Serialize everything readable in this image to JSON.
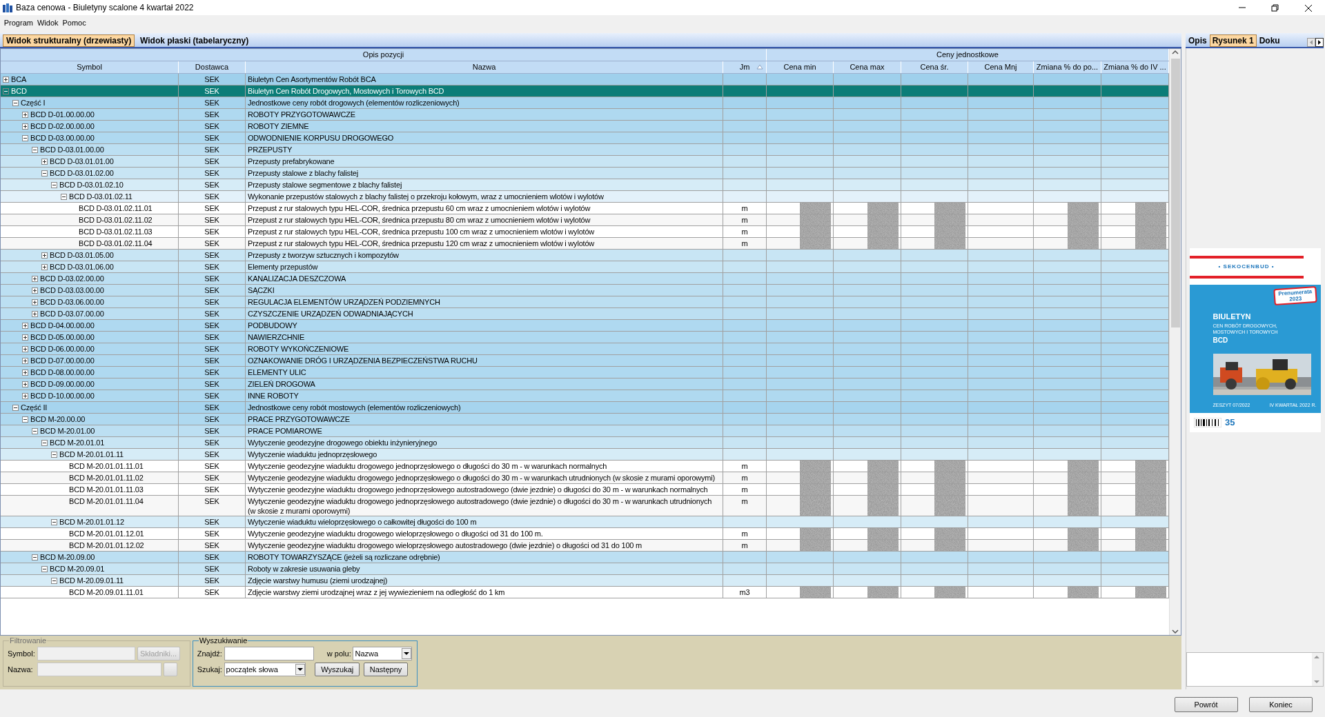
{
  "window": {
    "title": "Baza cenowa - Biuletyny scalone 4 kwartał 2022"
  },
  "menu": [
    "Program",
    "Widok",
    "Pomoc"
  ],
  "view_tabs": [
    {
      "label": "Widok strukturalny (drzewiasty)",
      "selected": true
    },
    {
      "label": "Widok płaski (tabelaryczny)",
      "selected": false
    }
  ],
  "table": {
    "groups": [
      "Opis pozycji",
      "Ceny jednostkowe"
    ],
    "columns": [
      {
        "label": "Symbol",
        "sorted": false
      },
      {
        "label": "Dostawca",
        "sorted": false
      },
      {
        "label": "Nazwa",
        "sorted": false
      },
      {
        "label": "Jm",
        "sorted": true
      },
      {
        "label": "Cena min",
        "sorted": false
      },
      {
        "label": "Cena max",
        "sorted": false
      },
      {
        "label": "Cena śr.",
        "sorted": false
      },
      {
        "label": "Cena Mnj",
        "sorted": false
      },
      {
        "label": "Zmiana % do po...",
        "sorted": false
      },
      {
        "label": "Zmiana % do IV ...",
        "sorted": false
      }
    ],
    "rows": [
      {
        "symbol": "BCA",
        "supplier": "SEK",
        "name": "Biuletyn Cen Asortymentów Robót BCA",
        "expanded": false,
        "selected": false
      },
      {
        "symbol": "BCD",
        "supplier": "SEK",
        "name": "Biuletyn Cen Robót Drogowych, Mostowych i Torowych BCD",
        "expanded": true,
        "selected": true,
        "children": [
          {
            "symbol": "Część I",
            "supplier": "SEK",
            "name": "Jednostkowe ceny robót drogowych (elementów rozliczeniowych)",
            "expanded": true,
            "selected": false,
            "children": [
              {
                "symbol": "BCD D-01.00.00.00",
                "supplier": "SEK",
                "name": "ROBOTY PRZYGOTOWAWCZE",
                "expanded": false,
                "selected": false
              },
              {
                "symbol": "BCD D-02.00.00.00",
                "supplier": "SEK",
                "name": "ROBOTY ZIEMNE",
                "expanded": false,
                "selected": false
              },
              {
                "symbol": "BCD D-03.00.00.00",
                "supplier": "SEK",
                "name": "ODWODNIENIE KORPUSU DROGOWEGO",
                "expanded": true,
                "selected": false,
                "children": [
                  {
                    "symbol": "BCD D-03.01.00.00",
                    "supplier": "SEK",
                    "name": "PRZEPUSTY",
                    "expanded": true,
                    "selected": false,
                    "children": [
                      {
                        "symbol": "BCD D-03.01.01.00",
                        "supplier": "SEK",
                        "name": "Przepusty prefabrykowane",
                        "expanded": false,
                        "selected": false
                      },
                      {
                        "symbol": "BCD D-03.01.02.00",
                        "supplier": "SEK",
                        "name": "Przepusty stalowe z blachy falistej",
                        "expanded": true,
                        "selected": false,
                        "children": [
                          {
                            "symbol": "BCD D-03.01.02.10",
                            "supplier": "SEK",
                            "name": "Przepusty stalowe segmentowe z blachy falistej",
                            "expanded": true,
                            "selected": false,
                            "children": [
                              {
                                "symbol": "BCD D-03.01.02.11",
                                "supplier": "SEK",
                                "name": "Wykonanie przepustów stalowych z blachy falistej o przekroju kołowym, wraz z umocnieniem wlotów i wylotów",
                                "expanded": true,
                                "selected": false,
                                "children": [
                                  {
                                    "symbol": "BCD D-03.01.02.11.01",
                                    "supplier": "SEK",
                                    "name": "Przepust z rur stalowych typu HEL-COR, średnica przepustu 60 cm wraz z umocnieniem wlotów i wylotów",
                                    "unit": "m",
                                    "selected": false,
                                    "prices_blurred": true
                                  },
                                  {
                                    "symbol": "BCD D-03.01.02.11.02",
                                    "supplier": "SEK",
                                    "name": "Przepust z rur stalowych typu HEL-COR, średnica przepustu 80 cm wraz z umocnieniem wlotów i wylotów",
                                    "unit": "m",
                                    "selected": false,
                                    "prices_blurred": true
                                  },
                                  {
                                    "symbol": "BCD D-03.01.02.11.03",
                                    "supplier": "SEK",
                                    "name": "Przepust z rur stalowych typu HEL-COR, średnica przepustu 100 cm wraz z umocnieniem wlotów i wylotów",
                                    "unit": "m",
                                    "selected": false,
                                    "prices_blurred": true
                                  },
                                  {
                                    "symbol": "BCD D-03.01.02.11.04",
                                    "supplier": "SEK",
                                    "name": "Przepust z rur stalowych typu HEL-COR, średnica przepustu 120 cm wraz z umocnieniem wlotów i wylotów",
                                    "unit": "m",
                                    "selected": false,
                                    "prices_blurred": true
                                  }
                                ]
                              }
                            ]
                          }
                        ]
                      },
                      {
                        "symbol": "BCD D-03.01.05.00",
                        "supplier": "SEK",
                        "name": "Przepusty z tworzyw sztucznych i kompozytów",
                        "expanded": false,
                        "selected": false
                      },
                      {
                        "symbol": "BCD D-03.01.06.00",
                        "supplier": "SEK",
                        "name": "Elementy przepustów",
                        "expanded": false,
                        "selected": false
                      }
                    ]
                  },
                  {
                    "symbol": "BCD D-03.02.00.00",
                    "supplier": "SEK",
                    "name": "KANALIZACJA DESZCZOWA",
                    "expanded": false,
                    "selected": false
                  },
                  {
                    "symbol": "BCD D-03.03.00.00",
                    "supplier": "SEK",
                    "name": "SĄCZKI",
                    "expanded": false,
                    "selected": false
                  },
                  {
                    "symbol": "BCD D-03.06.00.00",
                    "supplier": "SEK",
                    "name": "REGULACJA ELEMENTÓW URZĄDZEŃ PODZIEMNYCH",
                    "expanded": false,
                    "selected": false
                  },
                  {
                    "symbol": "BCD D-03.07.00.00",
                    "supplier": "SEK",
                    "name": "CZYSZCZENIE URZĄDZEŃ ODWADNIAJĄCYCH",
                    "expanded": false,
                    "selected": false
                  }
                ]
              },
              {
                "symbol": "BCD D-04.00.00.00",
                "supplier": "SEK",
                "name": "PODBUDOWY",
                "expanded": false,
                "selected": false
              },
              {
                "symbol": "BCD D-05.00.00.00",
                "supplier": "SEK",
                "name": "NAWIERZCHNIE",
                "expanded": false,
                "selected": false
              },
              {
                "symbol": "BCD D-06.00.00.00",
                "supplier": "SEK",
                "name": "ROBOTY WYKOŃCZENIOWE",
                "expanded": false,
                "selected": false
              },
              {
                "symbol": "BCD D-07.00.00.00",
                "supplier": "SEK",
                "name": "OZNAKOWANIE DRÓG I URZĄDZENIA BEZPIECZEŃSTWA RUCHU",
                "expanded": false,
                "selected": false
              },
              {
                "symbol": "BCD D-08.00.00.00",
                "supplier": "SEK",
                "name": "ELEMENTY ULIC",
                "expanded": false,
                "selected": false
              },
              {
                "symbol": "BCD D-09.00.00.00",
                "supplier": "SEK",
                "name": "ZIELEŃ DROGOWA",
                "expanded": false,
                "selected": false
              },
              {
                "symbol": "BCD D-10.00.00.00",
                "supplier": "SEK",
                "name": "INNE ROBOTY",
                "expanded": false,
                "selected": false
              }
            ]
          },
          {
            "symbol": "Część II",
            "supplier": "SEK",
            "name": "Jednostkowe ceny robót mostowych (elementów rozliczeniowych)",
            "expanded": true,
            "selected": false,
            "children": [
              {
                "symbol": "BCD M-20.00.00",
                "supplier": "SEK",
                "name": "PRACE PRZYGOTOWAWCZE",
                "expanded": true,
                "selected": false,
                "children": [
                  {
                    "symbol": "BCD M-20.01.00",
                    "supplier": "SEK",
                    "name": "PRACE POMIAROWE",
                    "expanded": true,
                    "selected": false,
                    "children": [
                      {
                        "symbol": "BCD M-20.01.01",
                        "supplier": "SEK",
                        "name": "Wytyczenie geodezyjne drogowego obiektu inżynieryjnego",
                        "expanded": true,
                        "selected": false,
                        "children": [
                          {
                            "symbol": "BCD M-20.01.01.11",
                            "supplier": "SEK",
                            "name": "Wytyczenie wiaduktu jednoprzęsłowego",
                            "expanded": true,
                            "selected": false,
                            "children": [
                              {
                                "symbol": "BCD M-20.01.01.11.01",
                                "supplier": "SEK",
                                "name": "Wytyczenie geodezyjne wiaduktu drogowego jednoprzęsłowego o długości do 30 m - w warunkach normalnych",
                                "unit": "m",
                                "selected": false,
                                "prices_blurred": true
                              },
                              {
                                "symbol": "BCD M-20.01.01.11.02",
                                "supplier": "SEK",
                                "name": "Wytyczenie geodezyjne wiaduktu drogowego jednoprzęsłowego o długości do 30 m - w warunkach utrudnionych (w skosie z murami oporowymi)",
                                "unit": "m",
                                "selected": false,
                                "prices_blurred": true
                              },
                              {
                                "symbol": "BCD M-20.01.01.11.03",
                                "supplier": "SEK",
                                "name": "Wytyczenie geodezyjne wiaduktu drogowego jednoprzęsłowego autostradowego (dwie jezdnie) o długości do 30 m - w warunkach normalnych",
                                "unit": "m",
                                "selected": false,
                                "prices_blurred": true
                              },
                              {
                                "symbol": "BCD M-20.01.01.11.04",
                                "supplier": "SEK",
                                "name": "Wytyczenie geodezyjne wiaduktu drogowego jednoprzęsłowego autostradowego (dwie jezdnie) o długości do 30 m - w warunkach utrudnionych (w skosie z murami oporowymi)",
                                "unit": "m",
                                "selected": false,
                                "prices_blurred": true
                              }
                            ]
                          },
                          {
                            "symbol": "BCD M-20.01.01.12",
                            "supplier": "SEK",
                            "name": "Wytyczenie wiaduktu wieloprzęsłowego o całkowitej długości do 100 m",
                            "expanded": true,
                            "selected": false,
                            "children": [
                              {
                                "symbol": "BCD M-20.01.01.12.01",
                                "supplier": "SEK",
                                "name": "Wytyczenie geodezyjne wiaduktu drogowego wieloprzęsłowego o długości od 31 do 100 m.",
                                "unit": "m",
                                "selected": false,
                                "prices_blurred": true
                              },
                              {
                                "symbol": "BCD M-20.01.01.12.02",
                                "supplier": "SEK",
                                "name": "Wytyczenie geodezyjne wiaduktu drogowego wieloprzęsłowego autostradowego (dwie jezdnie) o długości od 31 do 100 m",
                                "unit": "m",
                                "selected": false,
                                "prices_blurred": true
                              }
                            ]
                          }
                        ]
                      }
                    ]
                  },
                  {
                    "symbol": "BCD M-20.09.00",
                    "supplier": "SEK",
                    "name": "ROBOTY TOWARZYSZĄCE (jeżeli są rozliczane odrębnie)",
                    "expanded": true,
                    "selected": false,
                    "children": [
                      {
                        "symbol": "BCD M-20.09.01",
                        "supplier": "SEK",
                        "name": "Roboty w zakresie usuwania gleby",
                        "expanded": true,
                        "selected": false,
                        "children": [
                          {
                            "symbol": "BCD M-20.09.01.11",
                            "supplier": "SEK",
                            "name": "Zdjęcie warstwy humusu (ziemi urodzajnej)",
                            "expanded": true,
                            "selected": false,
                            "children": [
                              {
                                "symbol": "BCD M-20.09.01.11.01",
                                "supplier": "SEK",
                                "name": "Zdjęcie warstwy ziemi urodzajnej wraz z jej wywiezieniem na odległość do 1 km",
                                "unit": "m3",
                                "selected": false,
                                "prices_blurred": true
                              }
                            ]
                          }
                        ]
                      }
                    ]
                  }
                ]
              }
            ]
          }
        ]
      }
    ]
  },
  "filter": {
    "title": "Filtrowanie",
    "disabled": true,
    "symbol_label": "Symbol:",
    "name_label": "Nazwa:",
    "button": "Składniki..."
  },
  "search": {
    "title": "Wyszukiwanie",
    "find_label": "Znajdź:",
    "field_label": "w polu:",
    "field_value": "Nazwa",
    "mode_label": "Szukaj:",
    "mode_value": "początek słowa",
    "buttons": [
      "Wyszukaj",
      "Następny"
    ]
  },
  "side_panel": {
    "tabs": [
      {
        "label": "Opis",
        "selected": false
      },
      {
        "label": "Rysunek 1",
        "selected": true
      },
      {
        "label": "Doku",
        "selected": false
      }
    ],
    "cover": {
      "brand": "• SEKOCENBUD •",
      "stamp": "Prenumerata",
      "stamp_year": "2023",
      "title": "BIULETYN",
      "subtitle": [
        "CEN ROBÓT DROGOWYCH,",
        "MOSTOWYCH I TOROWYCH"
      ],
      "code": "BCD",
      "issue": "ZESZYT 07/2022",
      "quarter": "IV KWARTAŁ 2022 R.",
      "badge": "35"
    }
  },
  "footer_buttons": [
    "Powrót",
    "Koniec"
  ]
}
